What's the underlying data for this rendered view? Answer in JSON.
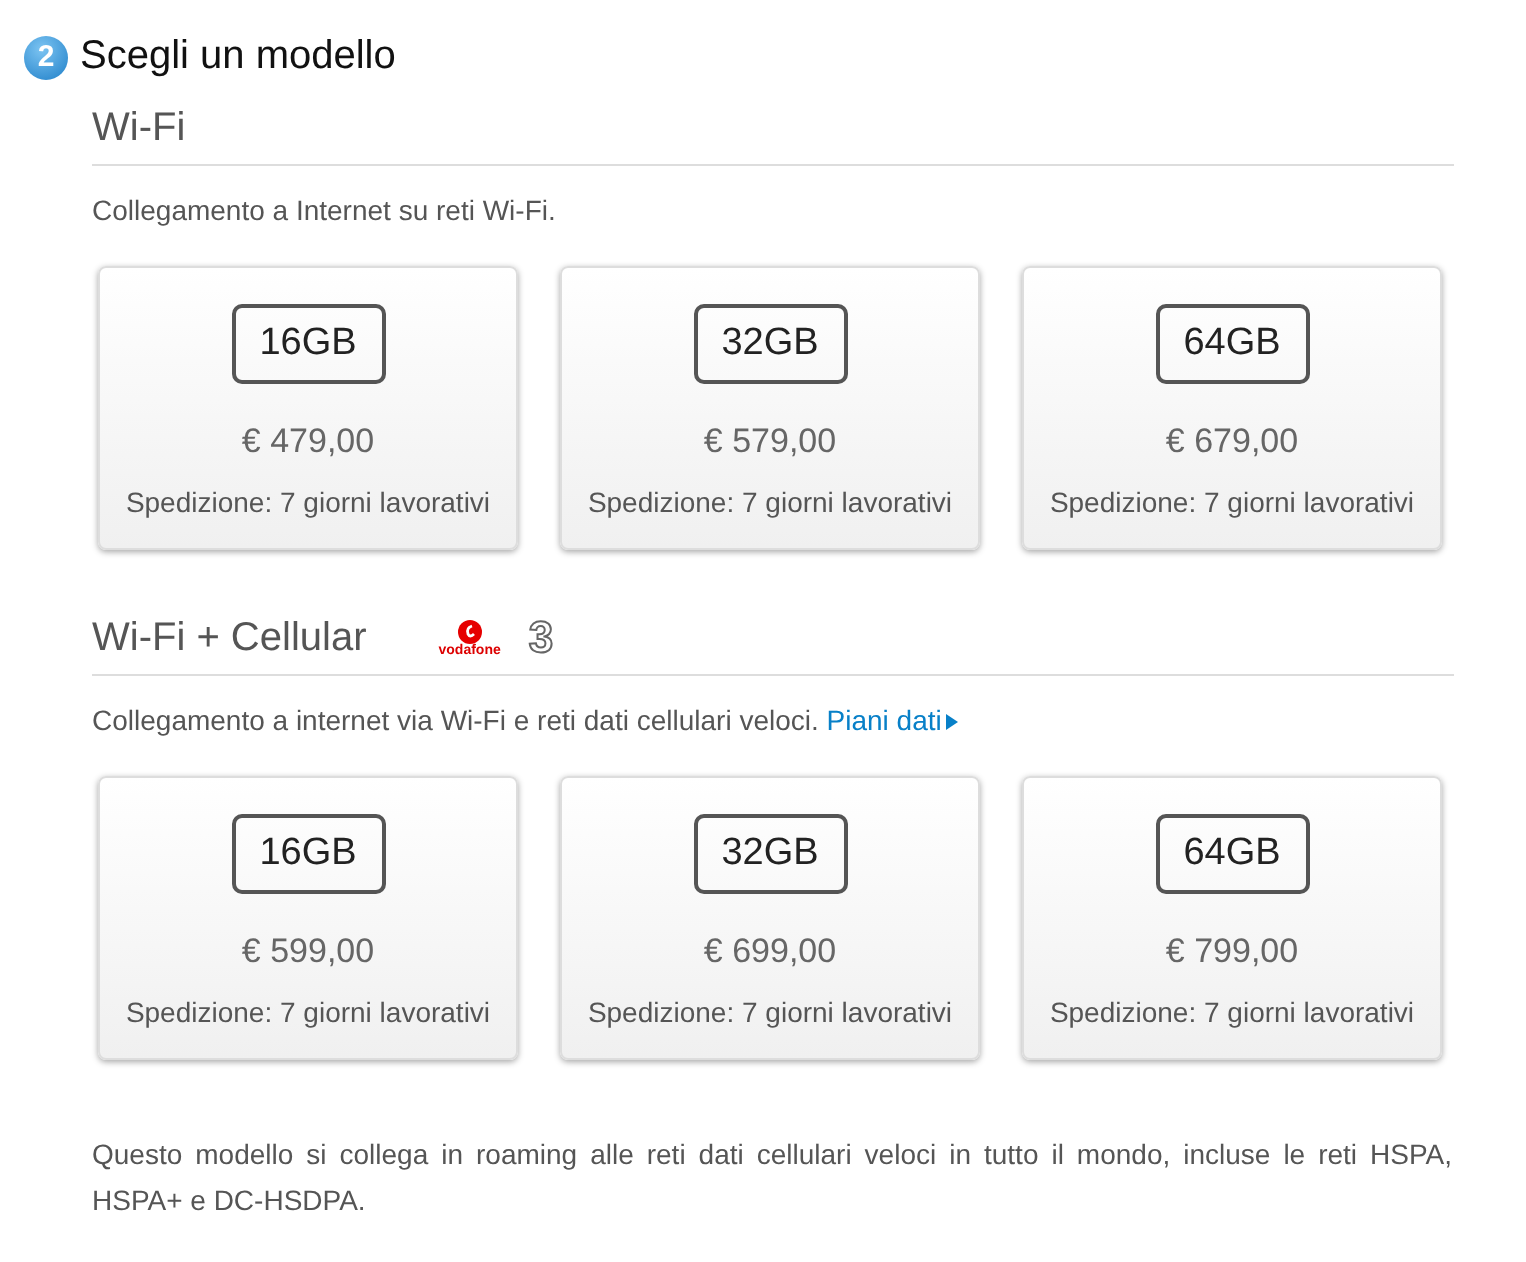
{
  "step": {
    "number": "2",
    "title": "Scegli un modello"
  },
  "sections": [
    {
      "title": "Wi-Fi",
      "description": "Collegamento a Internet su reti Wi-Fi.",
      "models": [
        {
          "capacity": "16GB",
          "price": "€ 479,00",
          "shipping": "Spedizione: 7 giorni lavorativi"
        },
        {
          "capacity": "32GB",
          "price": "€ 579,00",
          "shipping": "Spedizione: 7 giorni lavorativi"
        },
        {
          "capacity": "64GB",
          "price": "€ 679,00",
          "shipping": "Spedizione: 7 giorni lavorativi"
        }
      ]
    },
    {
      "title": "Wi-Fi + Cellular",
      "carriers": [
        {
          "kind": "vodafone",
          "label": "vodafone"
        },
        {
          "kind": "three",
          "label": "3"
        }
      ],
      "description": "Collegamento a internet via Wi-Fi e reti dati cellulari veloci.",
      "link": "Piani dati",
      "models": [
        {
          "capacity": "16GB",
          "price": "€ 599,00",
          "shipping": "Spedizione: 7 giorni lavorativi"
        },
        {
          "capacity": "32GB",
          "price": "€ 699,00",
          "shipping": "Spedizione: 7 giorni lavorativi"
        },
        {
          "capacity": "64GB",
          "price": "€ 799,00",
          "shipping": "Spedizione: 7 giorni lavorativi"
        }
      ]
    }
  ],
  "footnote": "Questo modello si collega in roaming alle reti dati cellulari veloci in tutto il mondo, incluse le reti HSPA, HSPA+ e DC-HSDPA."
}
